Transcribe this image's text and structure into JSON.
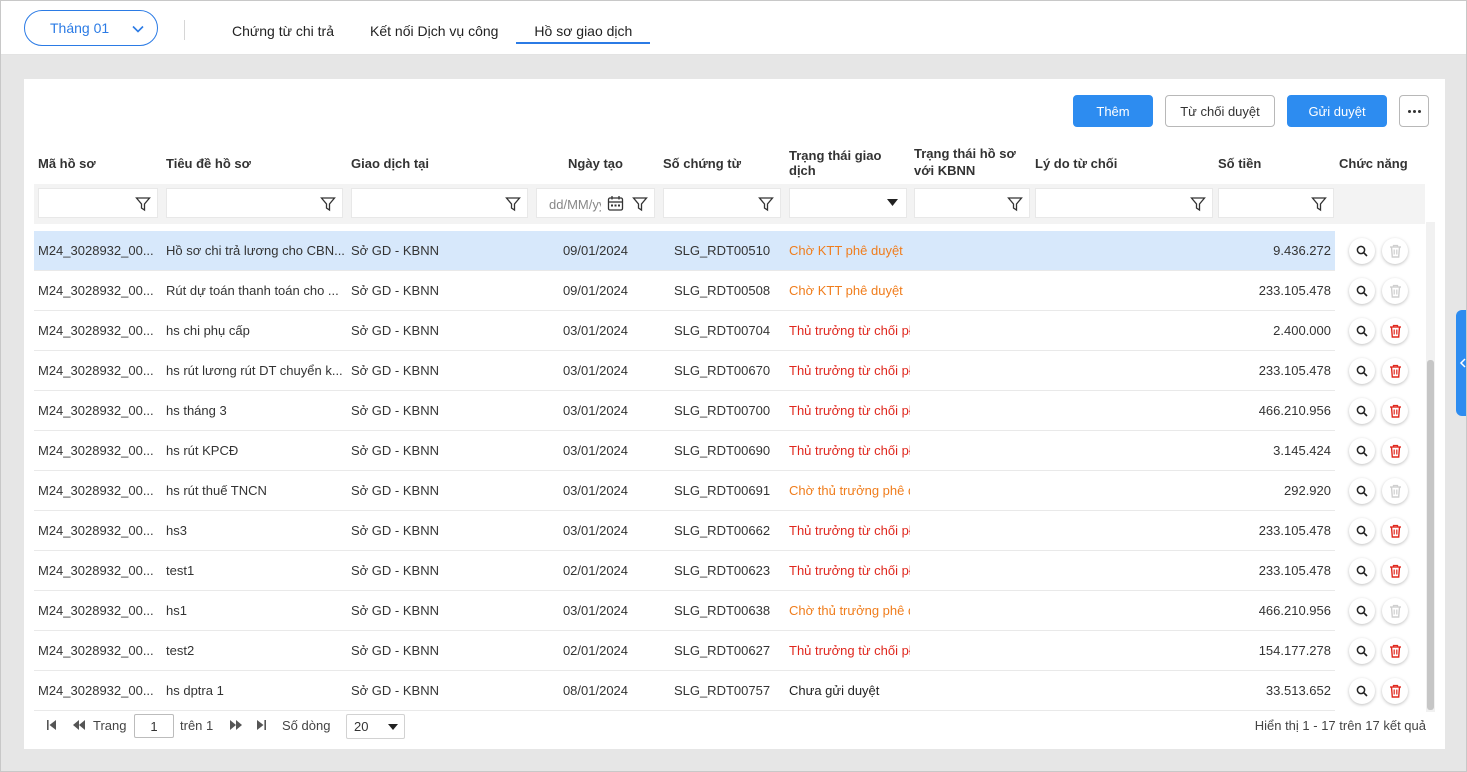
{
  "header": {
    "month_select": "Tháng 01",
    "tabs": [
      {
        "label": "Chứng từ chi trả"
      },
      {
        "label": "Kết nối Dịch vụ công"
      },
      {
        "label": "Hồ sơ giao dịch"
      }
    ]
  },
  "toolbar": {
    "add_label": "Thêm",
    "reject_label": "Từ chối duyệt",
    "send_label": "Gửi duyệt"
  },
  "table": {
    "columns": [
      {
        "label": "Mã hồ sơ"
      },
      {
        "label": "Tiêu đề hồ sơ"
      },
      {
        "label": "Giao dịch tại"
      },
      {
        "label": "Ngày tạo"
      },
      {
        "label": "Số chứng từ"
      },
      {
        "label": "Trạng thái giao dịch"
      },
      {
        "label": "Trạng thái hồ sơ với KBNN"
      },
      {
        "label": "Lý do từ chối"
      },
      {
        "label": "Số tiền"
      },
      {
        "label": "Chức năng"
      }
    ],
    "date_placeholder": "dd/MM/yyyy",
    "rows": [
      {
        "code": "M24_3028932_00...",
        "title": "Hồ sơ chi trả lương cho CBN...",
        "place": "Sở GD - KBNN",
        "date": "09/01/2024",
        "voucher": "SLG_RDT00510",
        "status": "Chờ KTT phê duyệt",
        "status_type": "orange",
        "kbnn": "",
        "reason": "",
        "amount": "9.436.272",
        "deletable": false
      },
      {
        "code": "M24_3028932_00...",
        "title": "Rút dự toán thanh toán cho ...",
        "place": "Sở GD - KBNN",
        "date": "09/01/2024",
        "voucher": "SLG_RDT00508",
        "status": "Chờ KTT phê duyệt",
        "status_type": "orange",
        "kbnn": "",
        "reason": "",
        "amount": "233.105.478",
        "deletable": false
      },
      {
        "code": "M24_3028932_00...",
        "title": "hs chi phụ cấp",
        "place": "Sở GD - KBNN",
        "date": "03/01/2024",
        "voucher": "SLG_RDT00704",
        "status": "Thủ trưởng từ chối pł",
        "status_type": "red",
        "kbnn": "",
        "reason": "",
        "amount": "2.400.000",
        "deletable": true
      },
      {
        "code": "M24_3028932_00...",
        "title": "hs rút lương rút DT chuyển k...",
        "place": "Sở GD - KBNN",
        "date": "03/01/2024",
        "voucher": "SLG_RDT00670",
        "status": "Thủ trưởng từ chối pł",
        "status_type": "red",
        "kbnn": "",
        "reason": "",
        "amount": "233.105.478",
        "deletable": true
      },
      {
        "code": "M24_3028932_00...",
        "title": "hs tháng 3",
        "place": "Sở GD - KBNN",
        "date": "03/01/2024",
        "voucher": "SLG_RDT00700",
        "status": "Thủ trưởng từ chối pł",
        "status_type": "red",
        "kbnn": "",
        "reason": "",
        "amount": "466.210.956",
        "deletable": true
      },
      {
        "code": "M24_3028932_00...",
        "title": "hs rút KPCĐ",
        "place": "Sở GD - KBNN",
        "date": "03/01/2024",
        "voucher": "SLG_RDT00690",
        "status": "Thủ trưởng từ chối pł",
        "status_type": "red",
        "kbnn": "",
        "reason": "",
        "amount": "3.145.424",
        "deletable": true
      },
      {
        "code": "M24_3028932_00...",
        "title": "hs rút thuế TNCN",
        "place": "Sở GD - KBNN",
        "date": "03/01/2024",
        "voucher": "SLG_RDT00691",
        "status": "Chờ thủ trưởng phê d",
        "status_type": "orange",
        "kbnn": "",
        "reason": "",
        "amount": "292.920",
        "deletable": false
      },
      {
        "code": "M24_3028932_00...",
        "title": "hs3",
        "place": "Sở GD - KBNN",
        "date": "03/01/2024",
        "voucher": "SLG_RDT00662",
        "status": "Thủ trưởng từ chối pł",
        "status_type": "red",
        "kbnn": "",
        "reason": "",
        "amount": "233.105.478",
        "deletable": true
      },
      {
        "code": "M24_3028932_00...",
        "title": "test1",
        "place": "Sở GD - KBNN",
        "date": "02/01/2024",
        "voucher": "SLG_RDT00623",
        "status": "Thủ trưởng từ chối pł",
        "status_type": "red",
        "kbnn": "",
        "reason": "",
        "amount": "233.105.478",
        "deletable": true
      },
      {
        "code": "M24_3028932_00...",
        "title": "hs1",
        "place": "Sở GD - KBNN",
        "date": "03/01/2024",
        "voucher": "SLG_RDT00638",
        "status": "Chờ thủ trưởng phê d",
        "status_type": "orange",
        "kbnn": "",
        "reason": "",
        "amount": "466.210.956",
        "deletable": false
      },
      {
        "code": "M24_3028932_00...",
        "title": "test2",
        "place": "Sở GD - KBNN",
        "date": "02/01/2024",
        "voucher": "SLG_RDT00627",
        "status": "Thủ trưởng từ chối pł",
        "status_type": "red",
        "kbnn": "",
        "reason": "",
        "amount": "154.177.278",
        "deletable": true
      },
      {
        "code": "M24_3028932_00...",
        "title": "hs dptra 1",
        "place": "Sở GD - KBNN",
        "date": "08/01/2024",
        "voucher": "SLG_RDT00757",
        "status": "Chưa gửi duyệt",
        "status_type": "black",
        "kbnn": "",
        "reason": "",
        "amount": "33.513.652",
        "deletable": true
      }
    ]
  },
  "pager": {
    "page_label": "Trang",
    "page_value": "1",
    "of_label": "trên 1",
    "rows_label": "Số dòng",
    "rows_value": "20",
    "summary": "Hiển thị 1 - 17 trên 17 kết quả"
  },
  "colors": {
    "accent": "#2d8cf0",
    "status_orange": "#f07d1c",
    "status_red": "#e0281e",
    "selected_row": "#d7e8fb"
  },
  "icons": [
    "chevron-down-icon",
    "filter-icon",
    "calendar-icon",
    "search-icon",
    "trash-icon",
    "first-page-icon",
    "prev-page-icon",
    "next-page-icon",
    "last-page-icon",
    "more-icon",
    "chevron-left-icon"
  ]
}
